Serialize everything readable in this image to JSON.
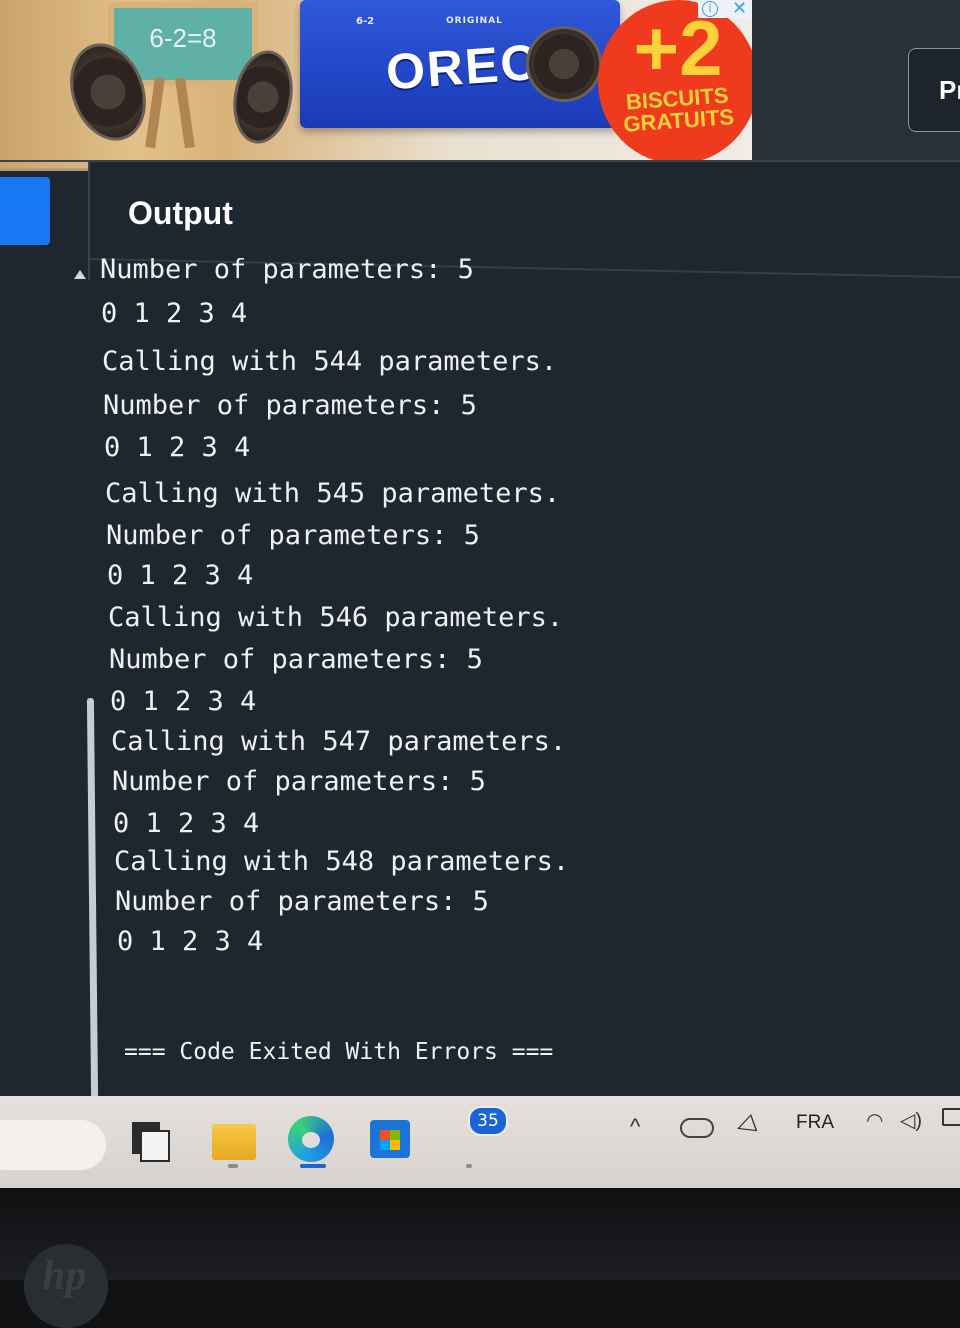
{
  "ad": {
    "chalkboard_text": "6-2=8",
    "pack_code": "6-2",
    "pack_subtitle": "ORIGINAL",
    "brand": "OREO",
    "promo_big": "+2",
    "promo_line1": "BISCUITS",
    "promo_line2": "GRATUITS",
    "info_icon": "i",
    "close_icon": "✕",
    "colors": {
      "pack": "#1f43c4",
      "promo": "#f03a1e",
      "promo_text": "#ffd23a"
    }
  },
  "side_button": {
    "label": "Pr"
  },
  "output_panel": {
    "title": "Output",
    "lines": [
      "Number of parameters: 5",
      "0 1 2 3 4",
      "Calling with 544 parameters.",
      "Number of parameters: 5",
      "0 1 2 3 4",
      "Calling with 545 parameters.",
      "Number of parameters: 5",
      "0 1 2 3 4",
      "Calling with 546 parameters.",
      "Number of parameters: 5",
      "0 1 2 3 4",
      "Calling with 547 parameters.",
      "Number of parameters: 5",
      "0 1 2 3 4",
      "Calling with 548 parameters.",
      "Number of parameters: 5",
      "0 1 2 3 4"
    ],
    "exit_message": "=== Code Exited With Errors ===",
    "colors": {
      "background": "#1e2630",
      "text": "#eef1f4",
      "run_button": "#1877f2"
    }
  },
  "taskbar": {
    "badge_count": "35",
    "language": "FRA",
    "icons": [
      "files-icon",
      "folder-icon",
      "edge-icon",
      "store-icon",
      "chevron-up-icon",
      "cloud-icon",
      "location-icon",
      "wifi-icon",
      "speaker-icon",
      "battery-icon"
    ]
  }
}
